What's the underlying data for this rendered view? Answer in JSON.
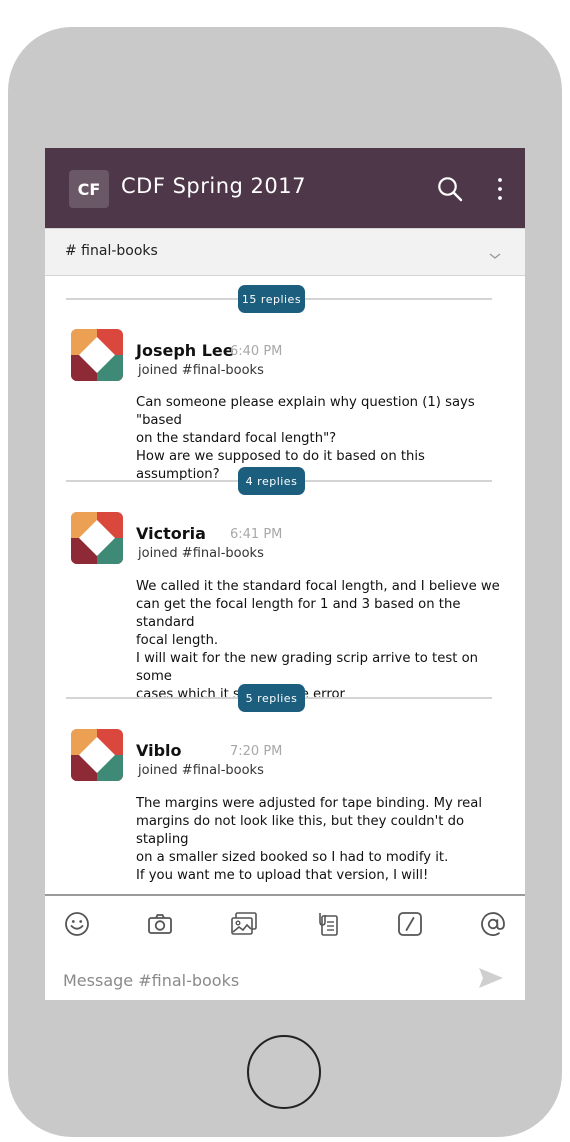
{
  "header": {
    "workspace_initials": "CF",
    "workspace_title": "CDF Spring 2017",
    "icons": {
      "search": "search-icon",
      "more": "more-vertical-icon"
    }
  },
  "channel": {
    "name": "# final-books",
    "dropdown_icon": "chevron-down-icon"
  },
  "threads": [
    {
      "replies_label": "15 replies",
      "author": "Joseph Lee",
      "time": "6:40 PM",
      "subtitle": "joined #final-books",
      "lines": [
        "Can someone please explain why question (1) says \"based",
        "on the standard focal length\"?",
        "How are we supposed to do it based on this assumption?"
      ]
    },
    {
      "replies_label": "4 replies",
      "author": "Victoria",
      "time": "6:41 PM",
      "subtitle": "joined #final-books",
      "lines": [
        "We called it the standard focal length, and I believe we",
        "can get the focal length for 1 and 3 based on the standard",
        "focal length.",
        "I will wait for the new grading scrip arrive to test on some",
        "cases which it should give error"
      ]
    },
    {
      "replies_label": "5 replies",
      "author": "Viblo",
      "time": "7:20 PM",
      "subtitle": "joined #final-books",
      "lines": [
        "The margins were adjusted for tape binding. My real",
        "margins do not look like this, but they couldn't do stapling",
        "on a smaller sized booked so I had to modify it.",
        "If you want me to upload that version, I will!"
      ]
    }
  ],
  "composer": {
    "placeholder": "Message #final-books",
    "tools": [
      "emoji-icon",
      "camera-icon",
      "image-gallery-icon",
      "file-attachment-icon",
      "slash-command-icon",
      "mention-icon"
    ],
    "send_icon": "send-icon"
  },
  "colors": {
    "header_bg": "#4d3749",
    "reply_pill": "#1c5e7d",
    "phone_frame": "#c9c9c9",
    "channel_bar": "#f2f2f2",
    "avatar_orange": "#eba054",
    "avatar_red": "#d9473d",
    "avatar_maroon": "#8e2a35",
    "avatar_green": "#3f8a76"
  }
}
